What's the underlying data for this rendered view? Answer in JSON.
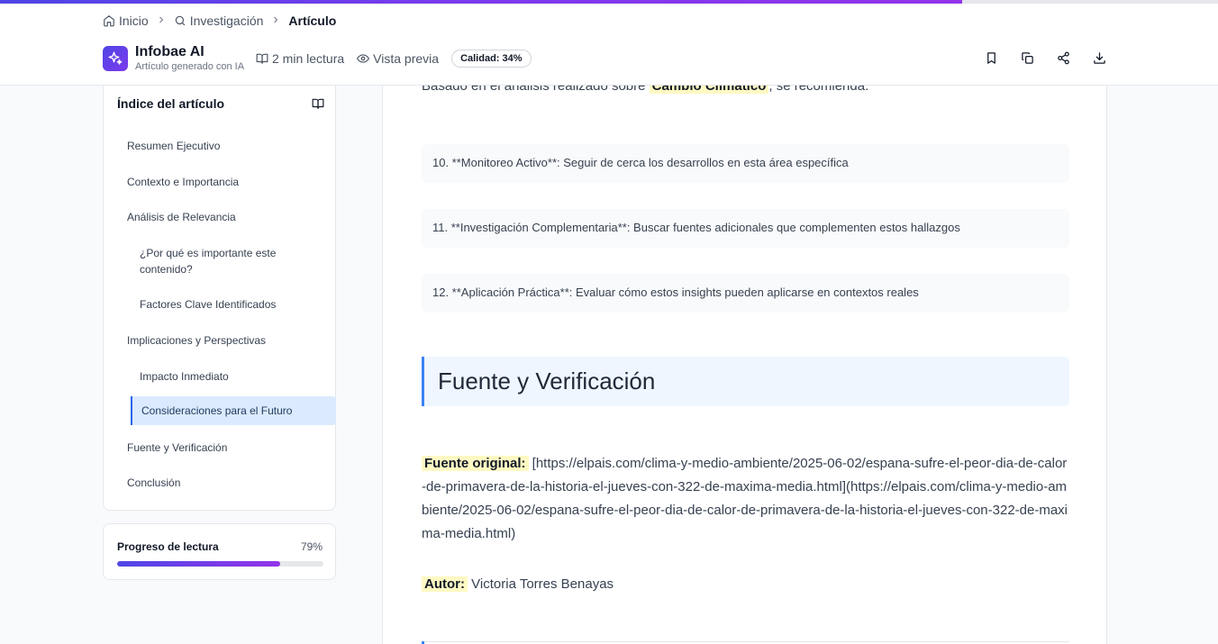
{
  "page_progress": 0.79,
  "breadcrumb": {
    "home": "Inicio",
    "research": "Investigación",
    "current": "Artículo"
  },
  "brand": {
    "name": "Infobae AI",
    "subtitle": "Artículo generado con IA"
  },
  "meta": {
    "read_time": "2 min lectura",
    "preview": "Vista previa",
    "quality": "Calidad: 34%"
  },
  "actions": [
    "bookmark-icon",
    "copy-icon",
    "share-icon",
    "download-icon"
  ],
  "toc": {
    "title": "Índice del artículo",
    "items": [
      {
        "label": "Resumen Ejecutivo",
        "level": 1
      },
      {
        "label": "Contexto e Importancia",
        "level": 1
      },
      {
        "label": "Análisis de Relevancia",
        "level": 1
      },
      {
        "label": "¿Por qué es importante este contenido?",
        "level": 2
      },
      {
        "label": "Factores Clave Identificados",
        "level": 2
      },
      {
        "label": "Implicaciones y Perspectivas",
        "level": 1
      },
      {
        "label": "Impacto Inmediato",
        "level": 2
      },
      {
        "label": "Consideraciones para el Futuro",
        "level": 2,
        "active": true
      },
      {
        "label": "Fuente y Verificación",
        "level": 1
      },
      {
        "label": "Conclusión",
        "level": 1
      }
    ]
  },
  "reading_progress": {
    "label": "Progreso de lectura",
    "percent_text": "79%",
    "value": 0.79
  },
  "article": {
    "intro_before": "Basado en el análisis realizado sobre",
    "intro_topic": "Cambio Climático",
    "intro_after": ", se recomienda:",
    "recommendations": [
      "10. **Monitoreo Activo**: Seguir de cerca los desarrollos en esta área específica",
      "11. **Investigación Complementaria**: Buscar fuentes adicionales que complementen estos hallazgos",
      "12. **Aplicación Práctica**: Evaluar cómo estos insights pueden aplicarse en contextos reales"
    ],
    "section_title": "Fuente y Verificación",
    "source_label": "Fuente original:",
    "source_text": "[https://elpais.com/clima-y-medio-ambiente/2025-06-02/espana-sufre-el-peor-dia-de-calor-de-primavera-de-la-historia-el-jueves-con-322-de-maxima-media.html](https://elpais.com/clima-y-medio-ambiente/2025-06-02/espana-sufre-el-peor-dia-de-calor-de-primavera-de-la-historia-el-jueves-con-322-de-maxima-media.html)",
    "author_label": "Autor:",
    "author_name": "Victoria Torres Benayas"
  }
}
